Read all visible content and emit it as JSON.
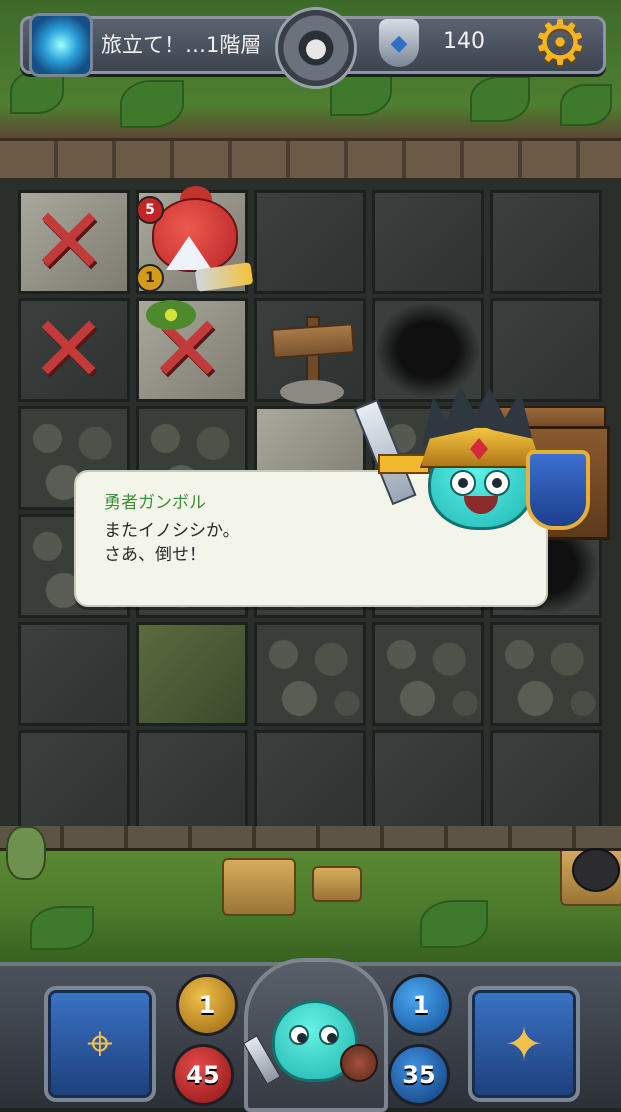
{
  "hud": {
    "portal_icon": "portal-icon",
    "floor_title": "旅立て！…1階層",
    "bomb_icon": "bomb-icon",
    "crest_icon": "crest-icon",
    "gem_count": "140",
    "settings_icon": "gear-icon"
  },
  "board": {
    "monster_hp": "5",
    "monster_attack": "1",
    "x_mark_glyph": "✕",
    "signpost_icon": "signpost-icon",
    "chest_icon": "treasure-chest-icon"
  },
  "dialog": {
    "speaker": "勇者ガンボル",
    "line1": "またイノシシか。",
    "line2": "さあ、倒せ！"
  },
  "player": {
    "attack": "1",
    "hp": "45",
    "magic": "1",
    "mp": "35",
    "skills_icon": "compass-helmet-icon",
    "inventory_icon": "spellbook-icon"
  }
}
